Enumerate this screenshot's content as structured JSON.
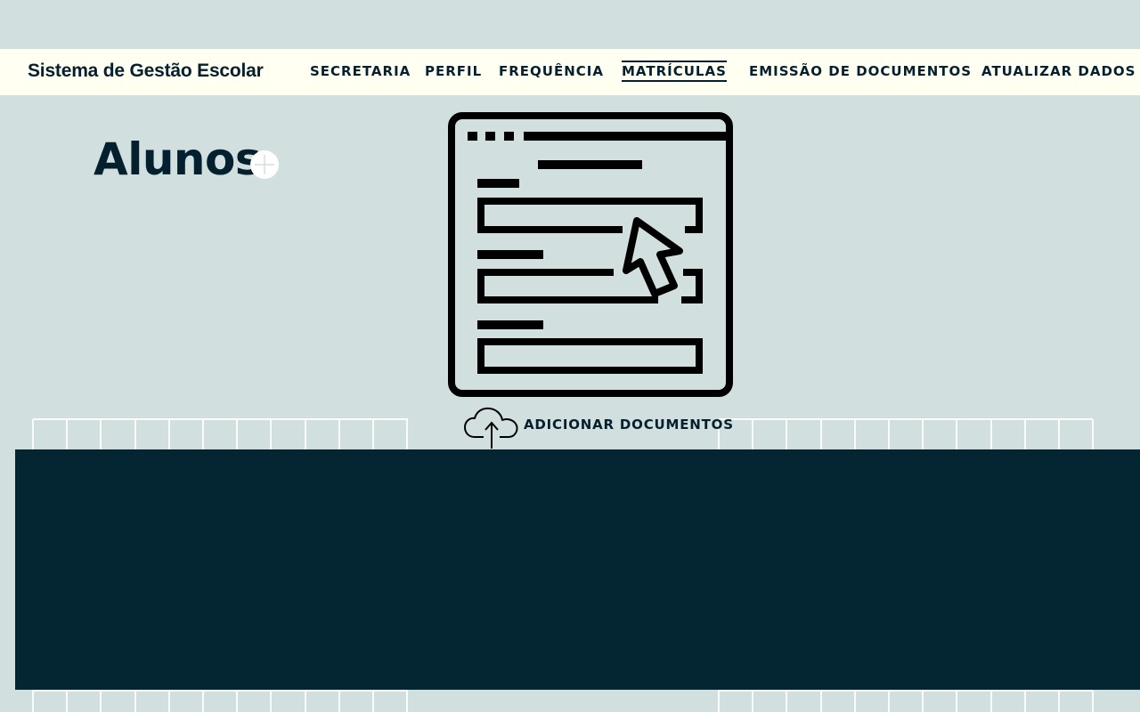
{
  "app": {
    "title": "Sistema de Gestão Escolar"
  },
  "nav": {
    "items": [
      {
        "id": "secretaria",
        "label": "SECRETARIA",
        "active": false
      },
      {
        "id": "perfil",
        "label": "PERFIL",
        "active": false
      },
      {
        "id": "frequencia",
        "label": "FREQUÊNCIA",
        "active": false
      },
      {
        "id": "matriculas",
        "label": "MATRÍCULAS",
        "active": true
      },
      {
        "id": "emissao",
        "label": "EMISSÃO DE DOCUMENTOS",
        "active": false
      },
      {
        "id": "atualizar",
        "label": "ATUALIZAR DADOS",
        "active": false
      }
    ]
  },
  "main": {
    "title": "Alunos",
    "add_icon": "plus-circle-icon",
    "illustration_icon": "form-window-cursor-icon",
    "upload": {
      "label": "ADICIONAR DOCUMENTOS",
      "icon": "cloud-upload-icon"
    }
  },
  "colors": {
    "background": "#d2dfdf",
    "navbar": "#fffff2",
    "text": "#04202e",
    "panel": "#042532",
    "grid_lines": "#ffffff"
  }
}
